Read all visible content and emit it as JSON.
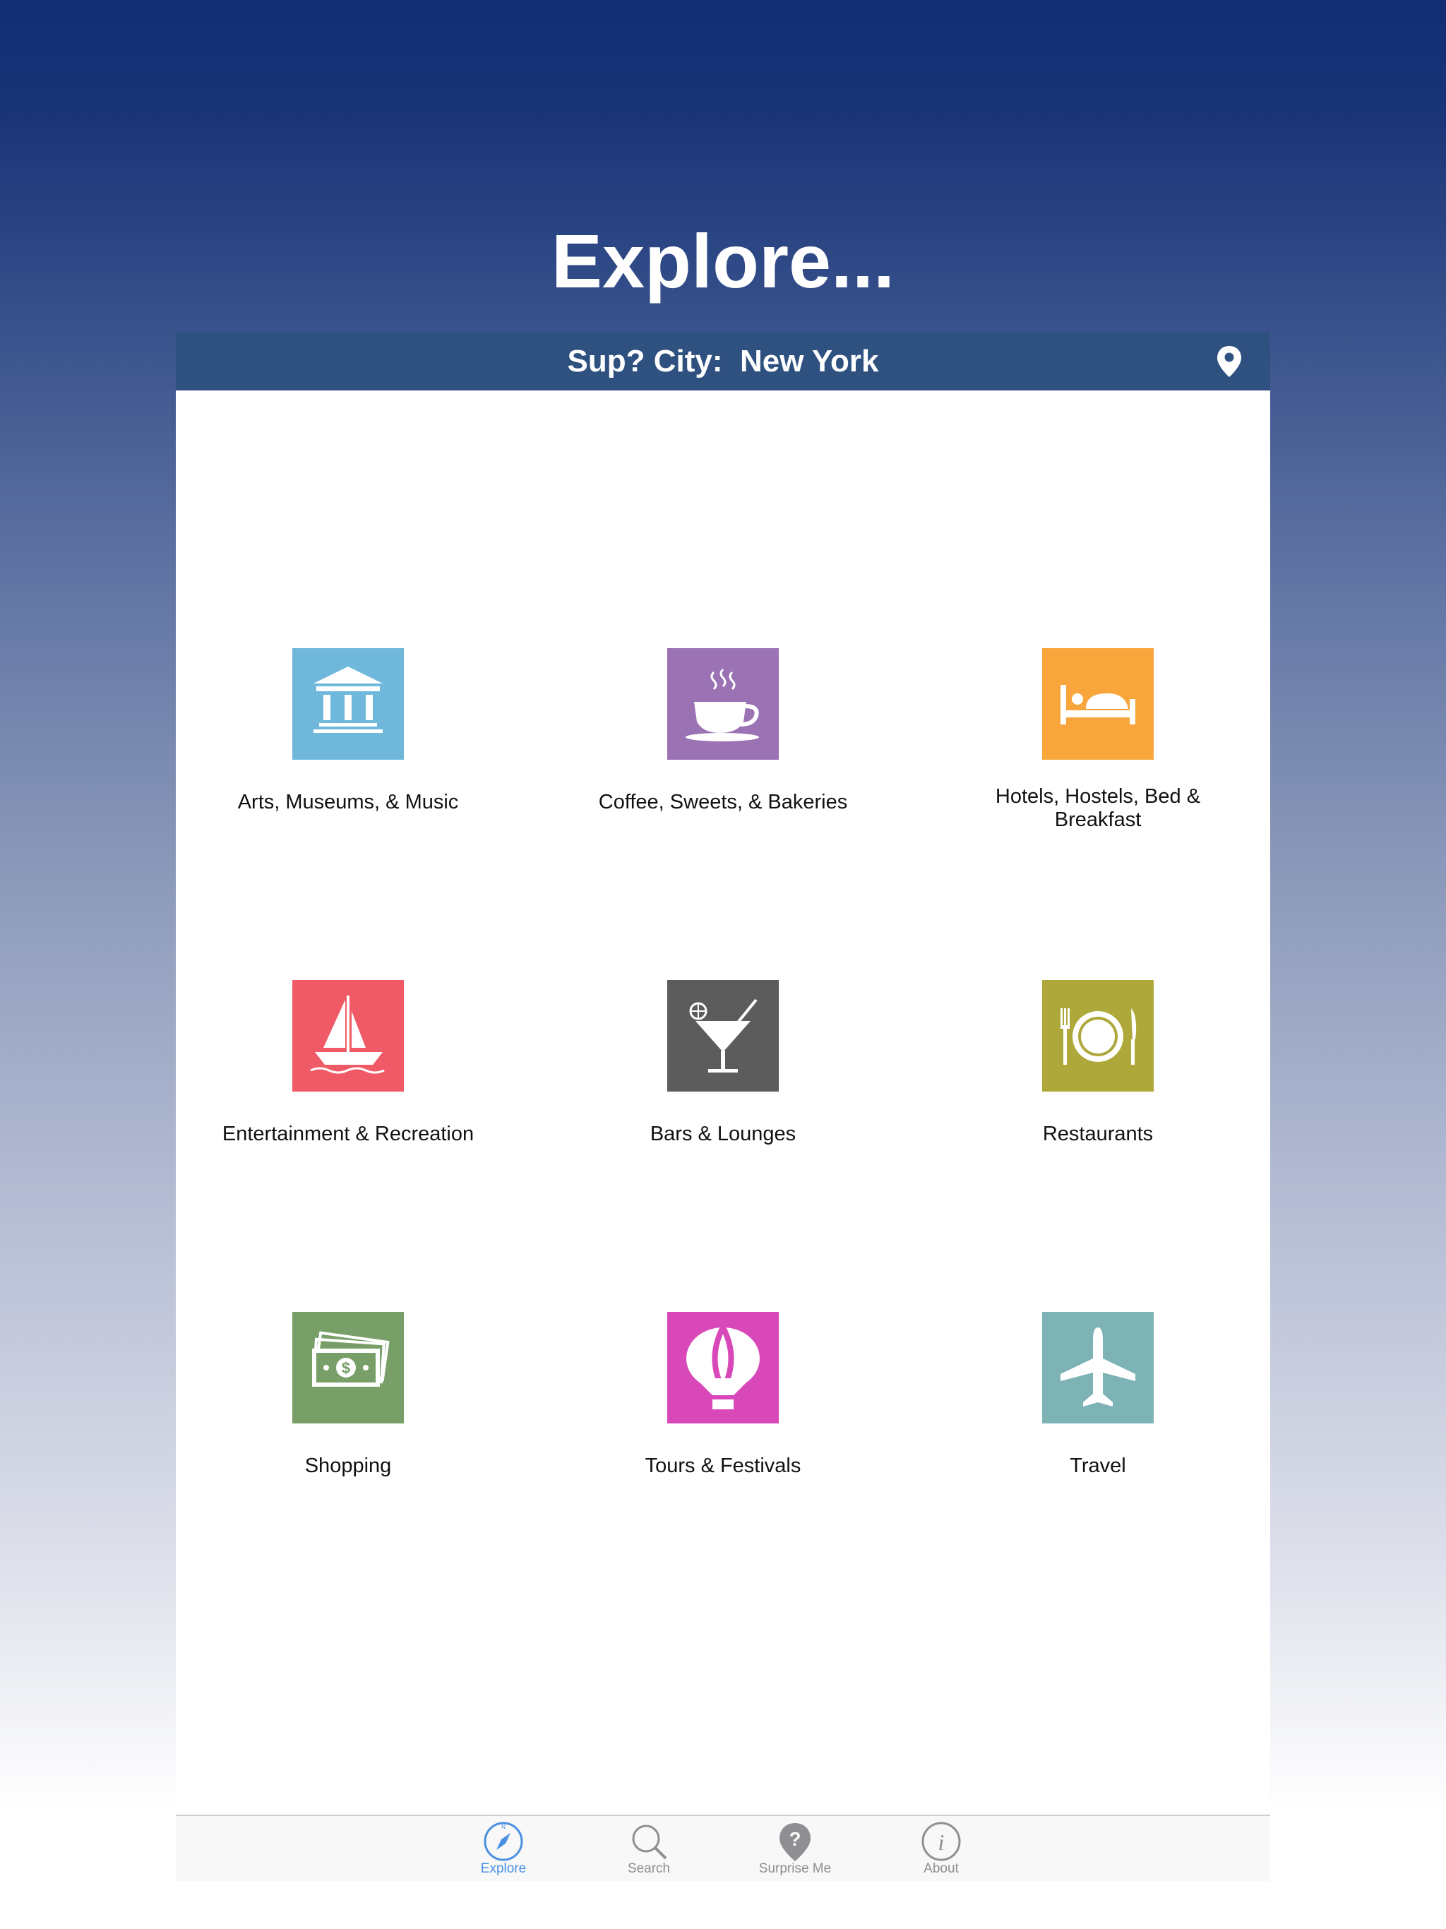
{
  "page": {
    "title": "Explore..."
  },
  "city_bar": {
    "text": "Sup? City:  New York"
  },
  "categories": [
    {
      "label": "Arts, Museums, & Music",
      "color": "#6fb8dc",
      "icon": "museum-icon"
    },
    {
      "label": "Coffee, Sweets, & Bakeries",
      "color": "#9b72b4",
      "icon": "coffee-cup-icon"
    },
    {
      "label": "Hotels, Hostels, Bed & Breakfast",
      "color": "#f8a63b",
      "icon": "bed-icon"
    },
    {
      "label": "Entertainment & Recreation",
      "color": "#f05a66",
      "icon": "sailboat-icon"
    },
    {
      "label": "Bars & Lounges",
      "color": "#5d5c5d",
      "icon": "cocktail-icon"
    },
    {
      "label": "Restaurants",
      "color": "#aea83a",
      "icon": "plate-cutlery-icon"
    },
    {
      "label": "Shopping",
      "color": "#789f68",
      "icon": "money-icon"
    },
    {
      "label": "Tours & Festivals",
      "color": "#d948b8",
      "icon": "hot-air-balloon-icon"
    },
    {
      "label": "Travel",
      "color": "#7db3b5",
      "icon": "airplane-icon"
    }
  ],
  "tabbar": {
    "tabs": [
      {
        "label": "Explore",
        "icon": "compass-icon",
        "active": true
      },
      {
        "label": "Search",
        "icon": "magnifier-icon",
        "active": false
      },
      {
        "label": "Surprise Me",
        "icon": "question-pin-icon",
        "active": false
      },
      {
        "label": "About",
        "icon": "info-icon",
        "active": false
      }
    ],
    "active_color": "#4a90e2",
    "inactive_color": "#8e8e93"
  }
}
